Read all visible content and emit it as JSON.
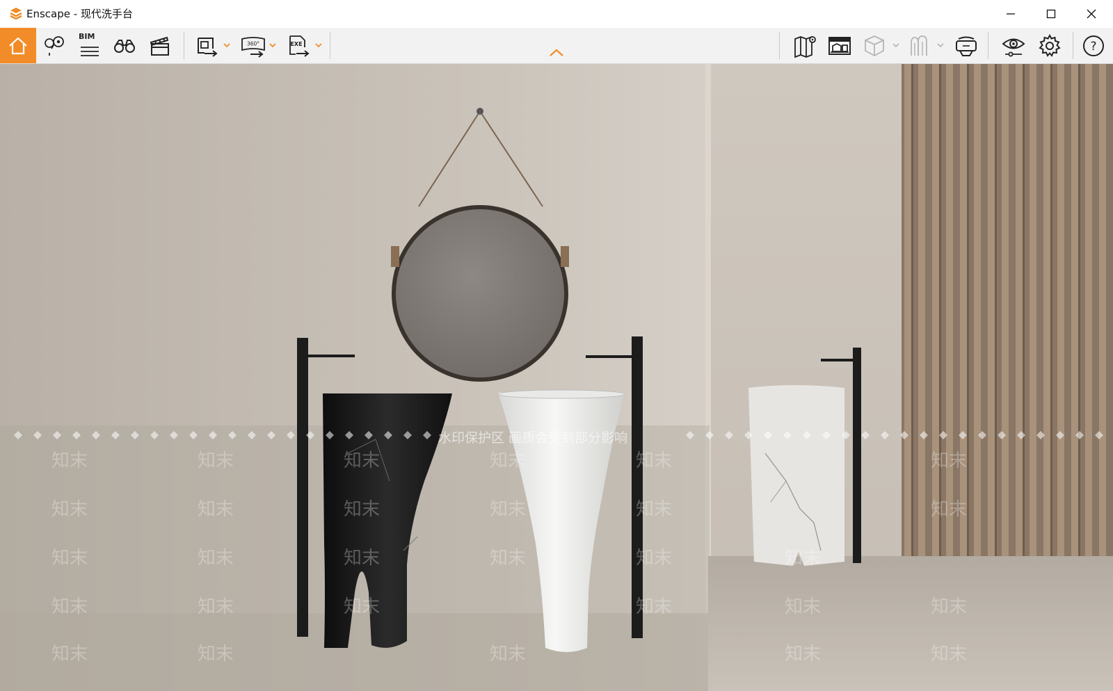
{
  "window": {
    "title": "Enscape - 现代洗手台",
    "controls": [
      "minimize-icon",
      "maximize-icon",
      "close-icon"
    ]
  },
  "toolbar": {
    "accent": "#f28c28",
    "left_tools": [
      "home-icon",
      "map-pin-icon",
      "bim-icon",
      "binoculars-icon",
      "clapperboard-icon",
      "render-image-export-icon",
      "panorama-360-icon",
      "exe-export-icon"
    ],
    "bim_label": "BIM",
    "pano_label": "360°",
    "exe_label": "EXE",
    "right_tools": [
      "map-icon",
      "asset-library-icon",
      "cube-icon",
      "atmosphere-icon",
      "vr-headset-icon",
      "eye-icon",
      "gear-icon",
      "help-icon"
    ],
    "help_label": "?"
  },
  "viewport": {
    "watermark_banner": "水印保护区   画质会受到部分影响",
    "watermark_mark": "知末"
  }
}
